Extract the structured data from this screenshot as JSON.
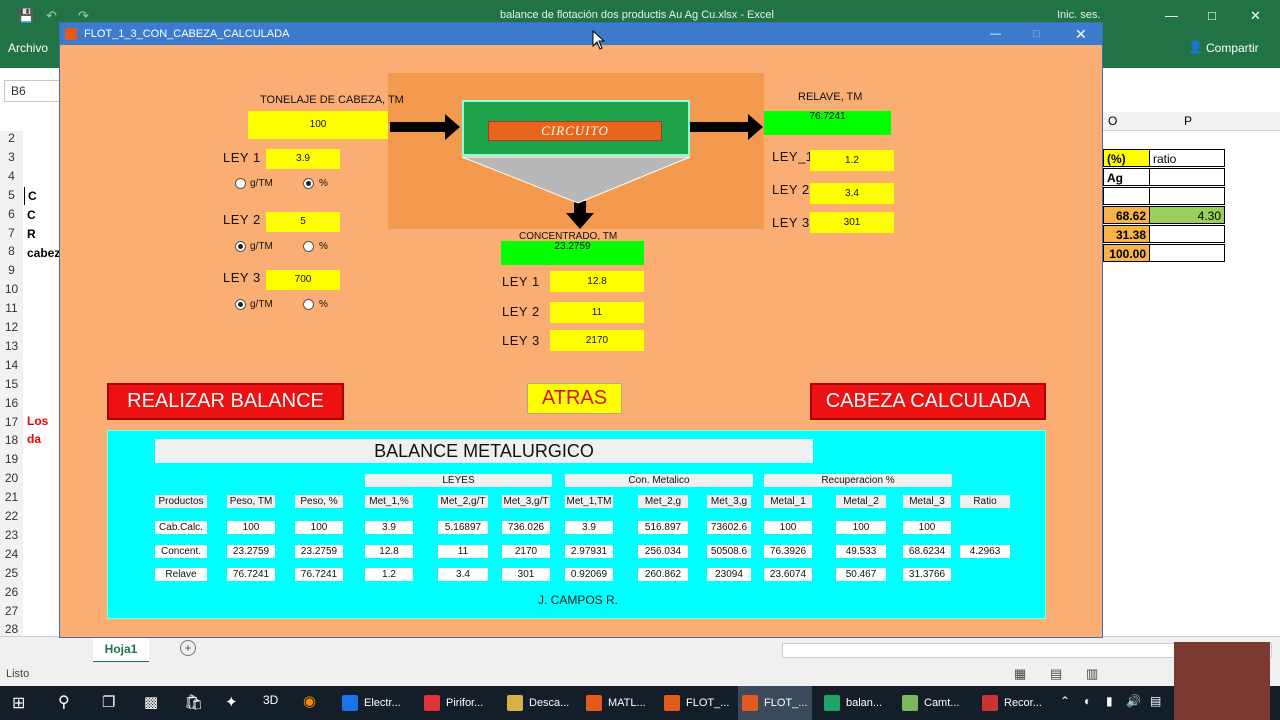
{
  "excel": {
    "title": "balance de flotación dos productis Au Ag Cu.xlsx - Excel",
    "signin": "Inic. ses.",
    "file_menu": "Archivo",
    "share": "Compartir",
    "namebox": "B6",
    "col_o": "O",
    "col_p": "P",
    "row_numbers": [
      "2",
      "3",
      "4",
      "5",
      "6",
      "7",
      "8",
      "9",
      "10",
      "11",
      "12",
      "13",
      "14",
      "15",
      "16",
      "17",
      "18",
      "19",
      "20",
      "21",
      "22",
      "23",
      "24",
      "25",
      "26",
      "27",
      "28"
    ],
    "left_cells": {
      "r5": "C",
      "r6": "C",
      "r7": "R",
      "r8": "cabez",
      "r17": "Los da"
    },
    "right_cells": {
      "o3": "(%)",
      "p3": "ratio",
      "o4": "Ag",
      "o6": "68.62",
      "p6": "4.30",
      "o7": "31.38",
      "o8": "100.00"
    },
    "sheet_tab": "Hoja1",
    "status": "Listo"
  },
  "figure": {
    "title": "FLOT_1_3_CON_CABEZA_CALCULADA",
    "tonelaje_label": "TONELAJE DE CABEZA, TM",
    "tonelaje_value": "100",
    "circuito": "CIRCUITO",
    "relave_label": "RELAVE, TM",
    "relave_value": "76.7241",
    "concentrado_label": "CONCENTRADO, TM",
    "concentrado_value": "23.2759",
    "head_leyes": [
      {
        "label": "LEY  1",
        "value": "3.9",
        "unit": "%"
      },
      {
        "label": "LEY  2",
        "value": "5",
        "unit": "g/TM"
      },
      {
        "label": "LEY  3",
        "value": "700",
        "unit": "g/TM"
      }
    ],
    "unit_gtm": "g/TM",
    "unit_pct": "%",
    "relave_leyes": [
      {
        "label": "LEY_1",
        "value": "1.2"
      },
      {
        "label": "LEY  2",
        "value": "3.4"
      },
      {
        "label": "LEY  3",
        "value": "301"
      }
    ],
    "conc_leyes": [
      {
        "label": "LEY  1",
        "value": "12.8"
      },
      {
        "label": "LEY  2",
        "value": "11"
      },
      {
        "label": "LEY  3",
        "value": "2170"
      }
    ],
    "btn_balance": "REALIZAR BALANCE",
    "btn_atras": "ATRAS",
    "btn_cabeza": "CABEZA CALCULADA",
    "table_title": "BALANCE METALURGICO",
    "group_leyes": "LEYES",
    "group_con": "Con. Metalico",
    "group_rec": "Recuperacion %",
    "headers": [
      "Productos",
      "Peso, TM",
      "Peso, %",
      "Met_1,%",
      "Met_2,g/T",
      "Met_3,g/T",
      "Met_1,TM",
      "Met_2,g",
      "Met_3,g",
      "Metal_1",
      "Metal_2",
      "Metal_3",
      "Ratio"
    ],
    "rows": [
      [
        "Cab.Calc.",
        "100",
        "100",
        "3.9",
        "5.16897",
        "736.026",
        "3.9",
        "516.897",
        "73602.6",
        "100",
        "100",
        "100",
        ""
      ],
      [
        "Concent.",
        "23.2759",
        "23.2759",
        "12.8",
        "11",
        "2170",
        "2.97931",
        "256.034",
        "50508.6",
        "76.3926",
        "49.533",
        "68.6234",
        "4.2963"
      ],
      [
        "Relave",
        "76.7241",
        "76.7241",
        "1.2",
        "3.4",
        "301",
        "0.92069",
        "260.862",
        "23094",
        "23.6074",
        "50.467",
        "31.3766",
        ""
      ]
    ],
    "author": "J. CAMPOS R."
  },
  "taskbar": {
    "items": [
      "Electr...",
      "Pirifor...",
      "Desca...",
      "MATL...",
      "FLOT_...",
      "FLOT_...",
      "balan...",
      "Camt...",
      "Recor..."
    ]
  },
  "colors": {
    "excel_green": "#217346",
    "figure_bg": "#fbae73",
    "panel_cyan": "#00ffff"
  }
}
